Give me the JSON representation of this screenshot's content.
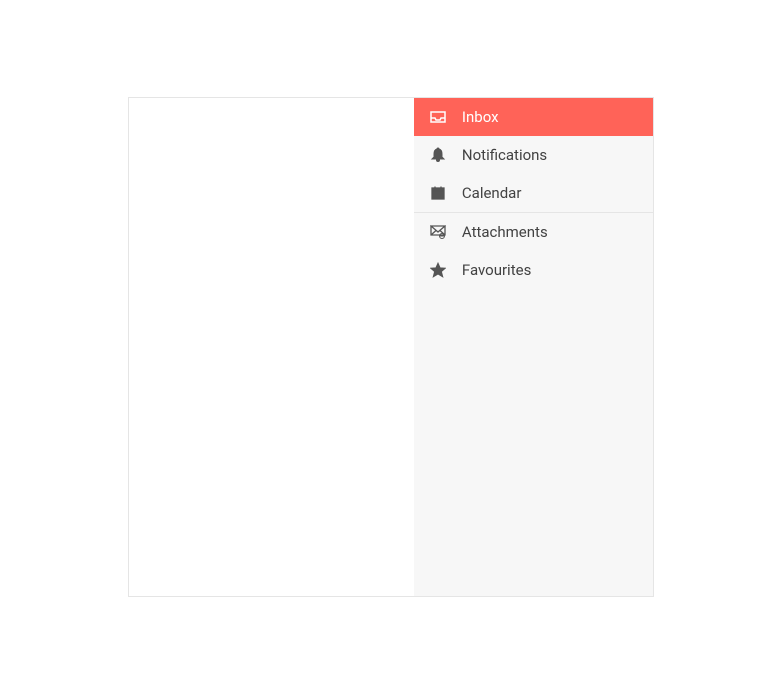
{
  "sidebar": {
    "groups": [
      {
        "items": [
          {
            "icon": "inbox-icon",
            "label": "Inbox",
            "active": true
          },
          {
            "icon": "bell-icon",
            "label": "Notifications",
            "active": false
          },
          {
            "icon": "calendar-icon",
            "label": "Calendar",
            "active": false
          }
        ]
      },
      {
        "items": [
          {
            "icon": "attachment-icon",
            "label": "Attachments",
            "active": false
          },
          {
            "icon": "star-icon",
            "label": "Favourites",
            "active": false
          }
        ]
      }
    ]
  }
}
